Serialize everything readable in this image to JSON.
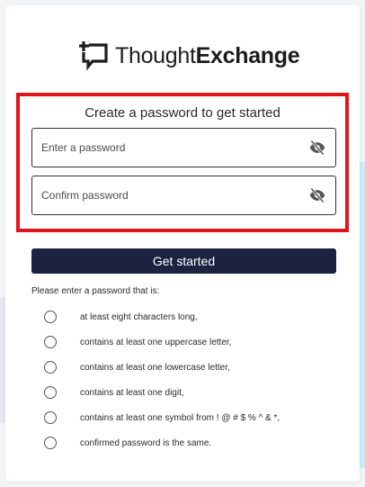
{
  "brand": {
    "name_light": "Thought",
    "name_bold": "Exchange",
    "logo_icon": "thoughtexchange-logo-icon"
  },
  "form": {
    "title": "Create a password to get started",
    "password_placeholder": "Enter a password",
    "confirm_placeholder": "Confirm password",
    "toggle_icon": "eye-slash-icon",
    "submit_label": "Get started"
  },
  "rules": {
    "title": "Please enter a password that is:",
    "items": [
      {
        "label": "at least eight characters long,"
      },
      {
        "label": "contains at least one uppercase letter,"
      },
      {
        "label": "contains at least one lowercase letter,"
      },
      {
        "label": "contains at least one digit,"
      },
      {
        "label": "contains at least one symbol from ! @ # $ % ^ & *,"
      },
      {
        "label": "confirmed password is the same."
      }
    ]
  },
  "colors": {
    "highlight": "#e0141b",
    "button_bg": "#1c2340"
  }
}
